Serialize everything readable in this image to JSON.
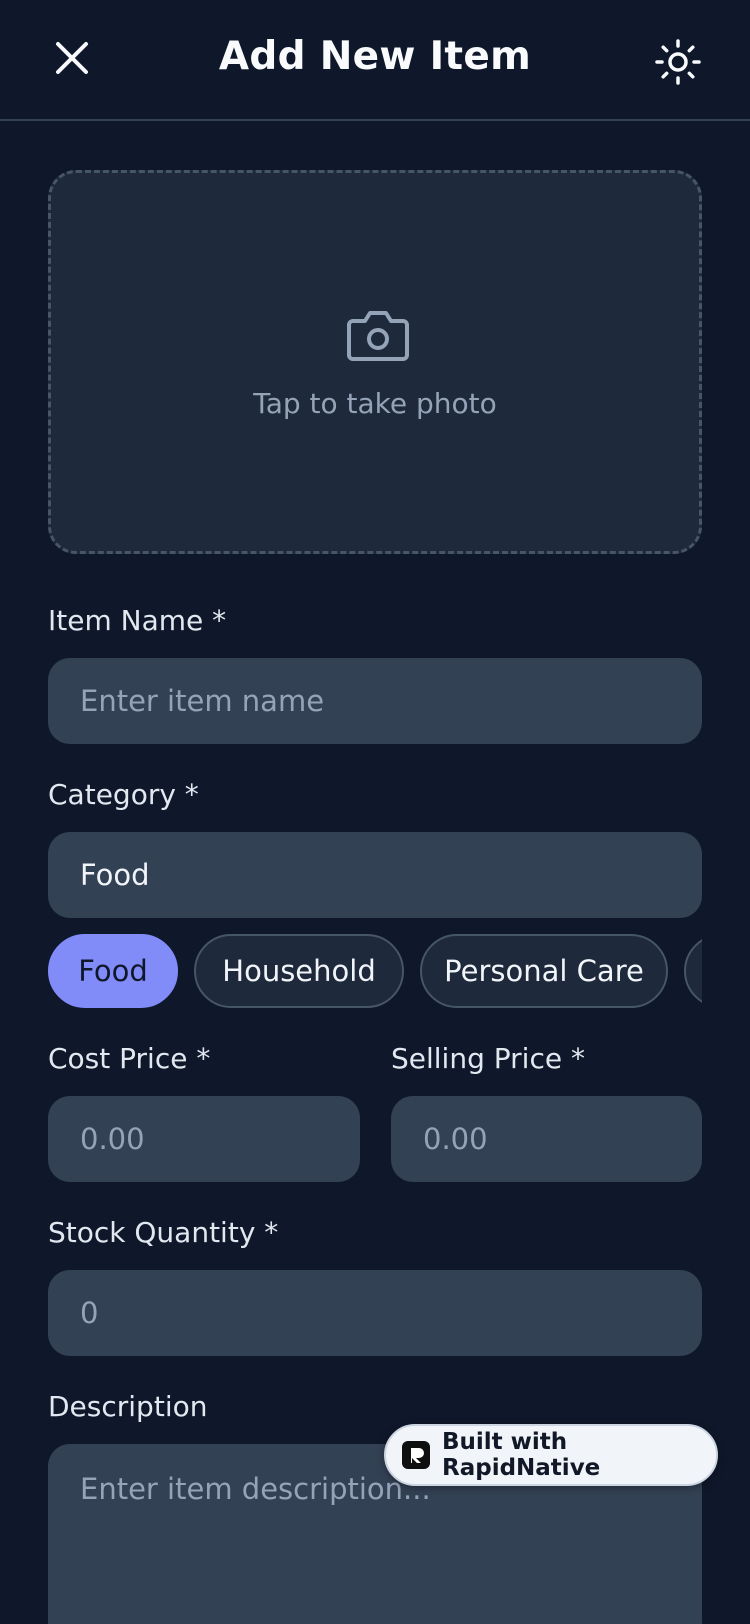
{
  "header": {
    "title": "Add New Item",
    "close_icon": "close-icon",
    "theme_icon": "sun-icon"
  },
  "photo": {
    "icon": "camera-icon",
    "prompt": "Tap to take photo"
  },
  "form": {
    "item_name": {
      "label": "Item Name *",
      "placeholder": "Enter item name",
      "value": ""
    },
    "category": {
      "label": "Category *",
      "value": "Food"
    },
    "category_chips": [
      {
        "label": "Food",
        "selected": true
      },
      {
        "label": "Household",
        "selected": false
      },
      {
        "label": "Personal Care",
        "selected": false
      },
      {
        "label": "",
        "selected": false
      }
    ],
    "cost_price": {
      "label": "Cost Price *",
      "placeholder": "0.00"
    },
    "selling_price": {
      "label": "Selling Price *",
      "placeholder": "0.00"
    },
    "stock_quantity": {
      "label": "Stock Quantity *",
      "placeholder": "0"
    },
    "description": {
      "label": "Description",
      "placeholder": "Enter item description..."
    }
  },
  "badge": {
    "text": "Built with RapidNative",
    "icon": "rapidnative-logo-icon"
  },
  "colors": {
    "background": "#0f172a",
    "surface": "#1e293b",
    "input": "#334155",
    "accent": "#818cf8",
    "muted_text": "#94a3b8"
  }
}
